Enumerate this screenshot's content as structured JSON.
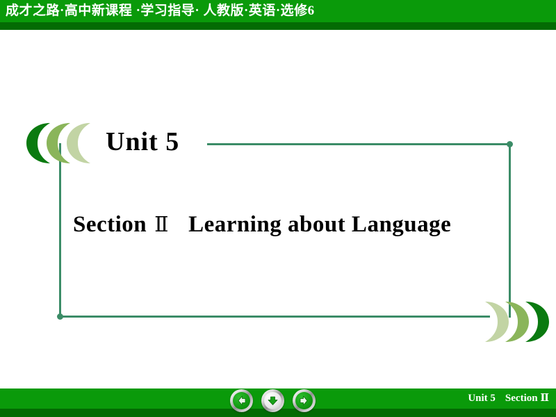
{
  "header": {
    "title": "成才之路·高中新课程 ·学习指导· 人教版·英语·选修6",
    "bar_color": "#0a9a0a",
    "shadow_color": "#036b03",
    "text_color": "#ffffff"
  },
  "slide": {
    "unit_label": "Unit 5",
    "section_prefix": "Section",
    "section_numeral": "Ⅱ",
    "section_name": "Learning about Language",
    "frame_color": "#3b8c67",
    "text_color": "#000000"
  },
  "decor": {
    "crescents_topleft": [
      {
        "name": "crescent-dark",
        "color": "#0a7a10"
      },
      {
        "name": "crescent-mid",
        "color": "#8ab55a"
      },
      {
        "name": "crescent-light",
        "color": "#c2d4a4"
      }
    ],
    "crescents_bottomright": [
      {
        "name": "crescent-light",
        "color": "#c2d4a4"
      },
      {
        "name": "crescent-mid",
        "color": "#8ab55a"
      },
      {
        "name": "crescent-dark",
        "color": "#0a7a10"
      }
    ]
  },
  "footer": {
    "unit_label": "Unit 5",
    "section_label": "Section",
    "section_numeral": "Ⅱ",
    "bar_color": "#0a9a0a",
    "shadow_color": "#036b03",
    "text_color": "#ffffff",
    "nav": {
      "prev": {
        "icon": "arrow-left-icon",
        "label": "Previous slide"
      },
      "down": {
        "icon": "arrow-down-icon",
        "label": "Next step"
      },
      "next": {
        "icon": "arrow-right-icon",
        "label": "Next slide"
      }
    }
  }
}
